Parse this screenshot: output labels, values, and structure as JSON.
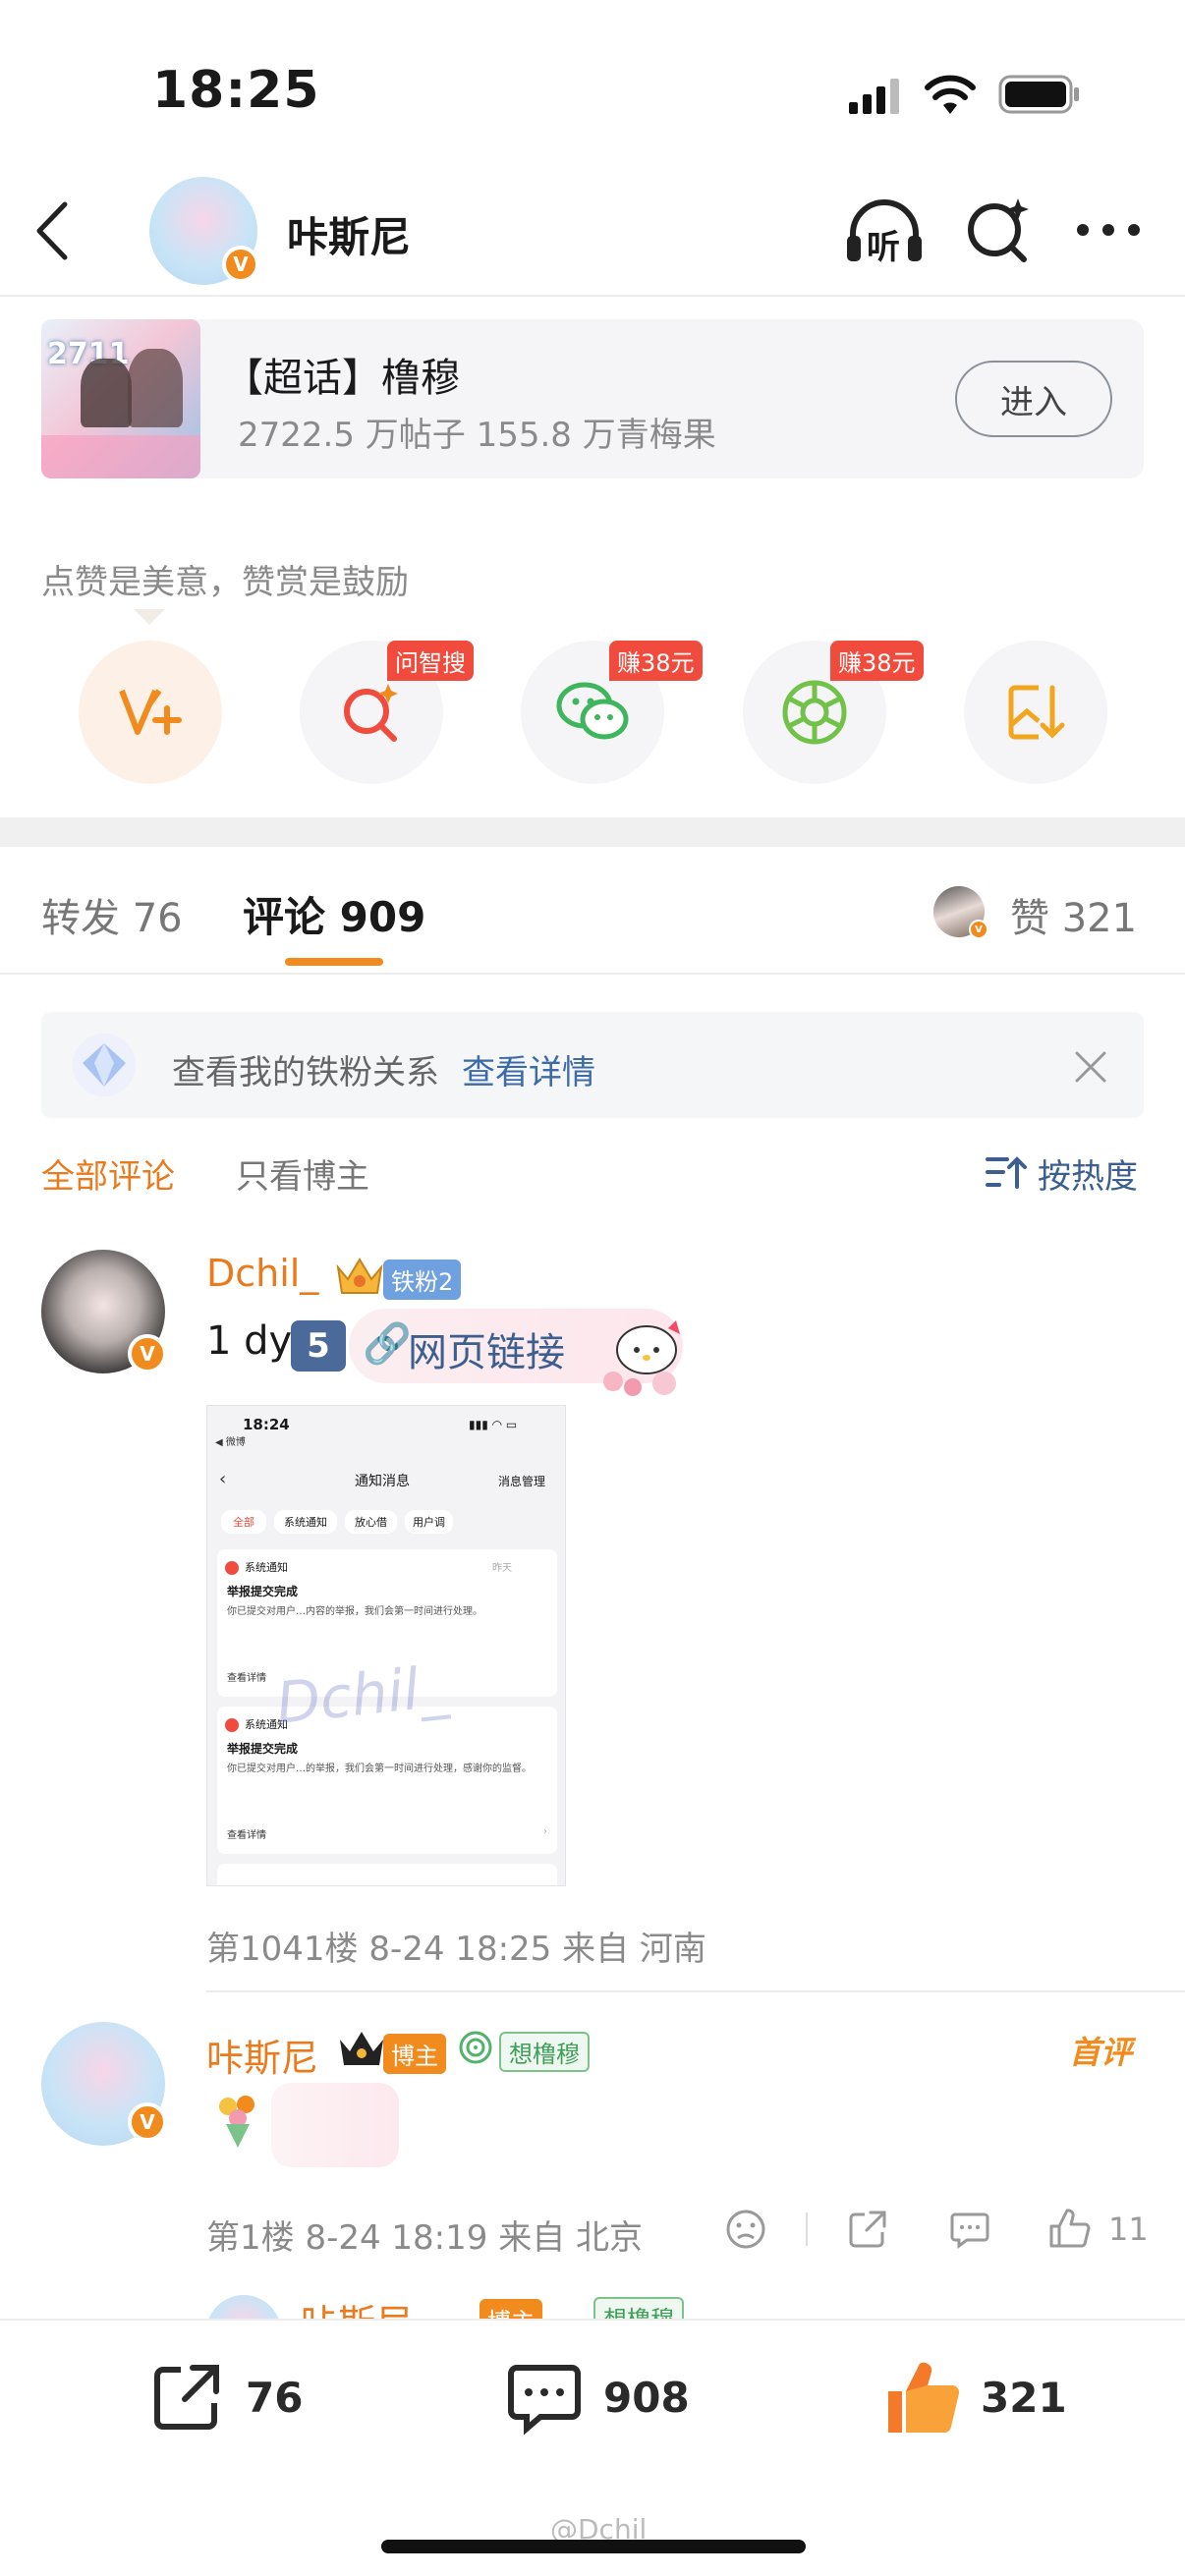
{
  "status_bar": {
    "time": "18:25"
  },
  "header": {
    "title": "咔斯尼",
    "listen_label": "听"
  },
  "topic": {
    "name": "【超话】橹穆",
    "stats": "2722.5 万帖子 155.8 万青梅果",
    "enter_label": "进入",
    "cover_text": "2711"
  },
  "reward": {
    "prompt": "点赞是美意，赞赏是鼓励",
    "items": [
      {
        "icon": "vplus-icon",
        "tag": ""
      },
      {
        "icon": "ai-search-icon",
        "tag": "问智搜"
      },
      {
        "icon": "wechat-icon",
        "tag": "赚38元"
      },
      {
        "icon": "moments-icon",
        "tag": "赚38元"
      },
      {
        "icon": "save-image-icon",
        "tag": ""
      }
    ]
  },
  "tabs": {
    "repost": "转发 76",
    "comment": "评论 909",
    "like": "赞 321"
  },
  "fan_bar": {
    "text": "查看我的铁粉关系",
    "link": "查看详情"
  },
  "filter": {
    "all": "全部评论",
    "author_only": "只看博主",
    "sort": "按热度"
  },
  "comments": [
    {
      "username": "Dchil_",
      "badge": "铁粉2",
      "text": "1 dy",
      "num_badge": "5",
      "link_text": "网页链接",
      "meta": "第1041楼 8-24 18:25 来自 河南",
      "screenshot": {
        "time": "18:24",
        "back_label": "◀ 微博",
        "title": "通知消息",
        "manage": "消息管理",
        "filters": [
          "全部",
          "系统通知",
          "放心借",
          "用户调"
        ],
        "card1_source": "系统通知",
        "card1_date": "昨天",
        "card1_title": "举报提交完成",
        "card1_body": "你已提交对用户…内容的举报，我们会第一时间进行处理。",
        "card1_more": "查看详情",
        "card2_source": "系统通知",
        "card2_title": "举报提交完成",
        "card2_body": "你已提交对用户…的举报，我们会第一时间进行处理，感谢你的监督。",
        "card2_more": "查看详情",
        "watermark": "Dchil_"
      }
    },
    {
      "username": "咔斯尼",
      "badge_author": "博主",
      "badge_group": "想橹穆",
      "first_label": "首评",
      "meta": "第1楼 8-24 18:19 来自 北京",
      "like_count": "11"
    }
  ],
  "next_comment_peek": {
    "username": "咔斯尼",
    "badge_author": "博主",
    "badge_group": "想橹穆"
  },
  "bottom_bar": {
    "repost_count": "76",
    "comment_count": "908",
    "like_count": "321"
  },
  "watermark": "@Dchil_",
  "colors": {
    "accent": "#f28b1e",
    "link": "#3d6aa8",
    "tag_red": "#f04b3d"
  }
}
